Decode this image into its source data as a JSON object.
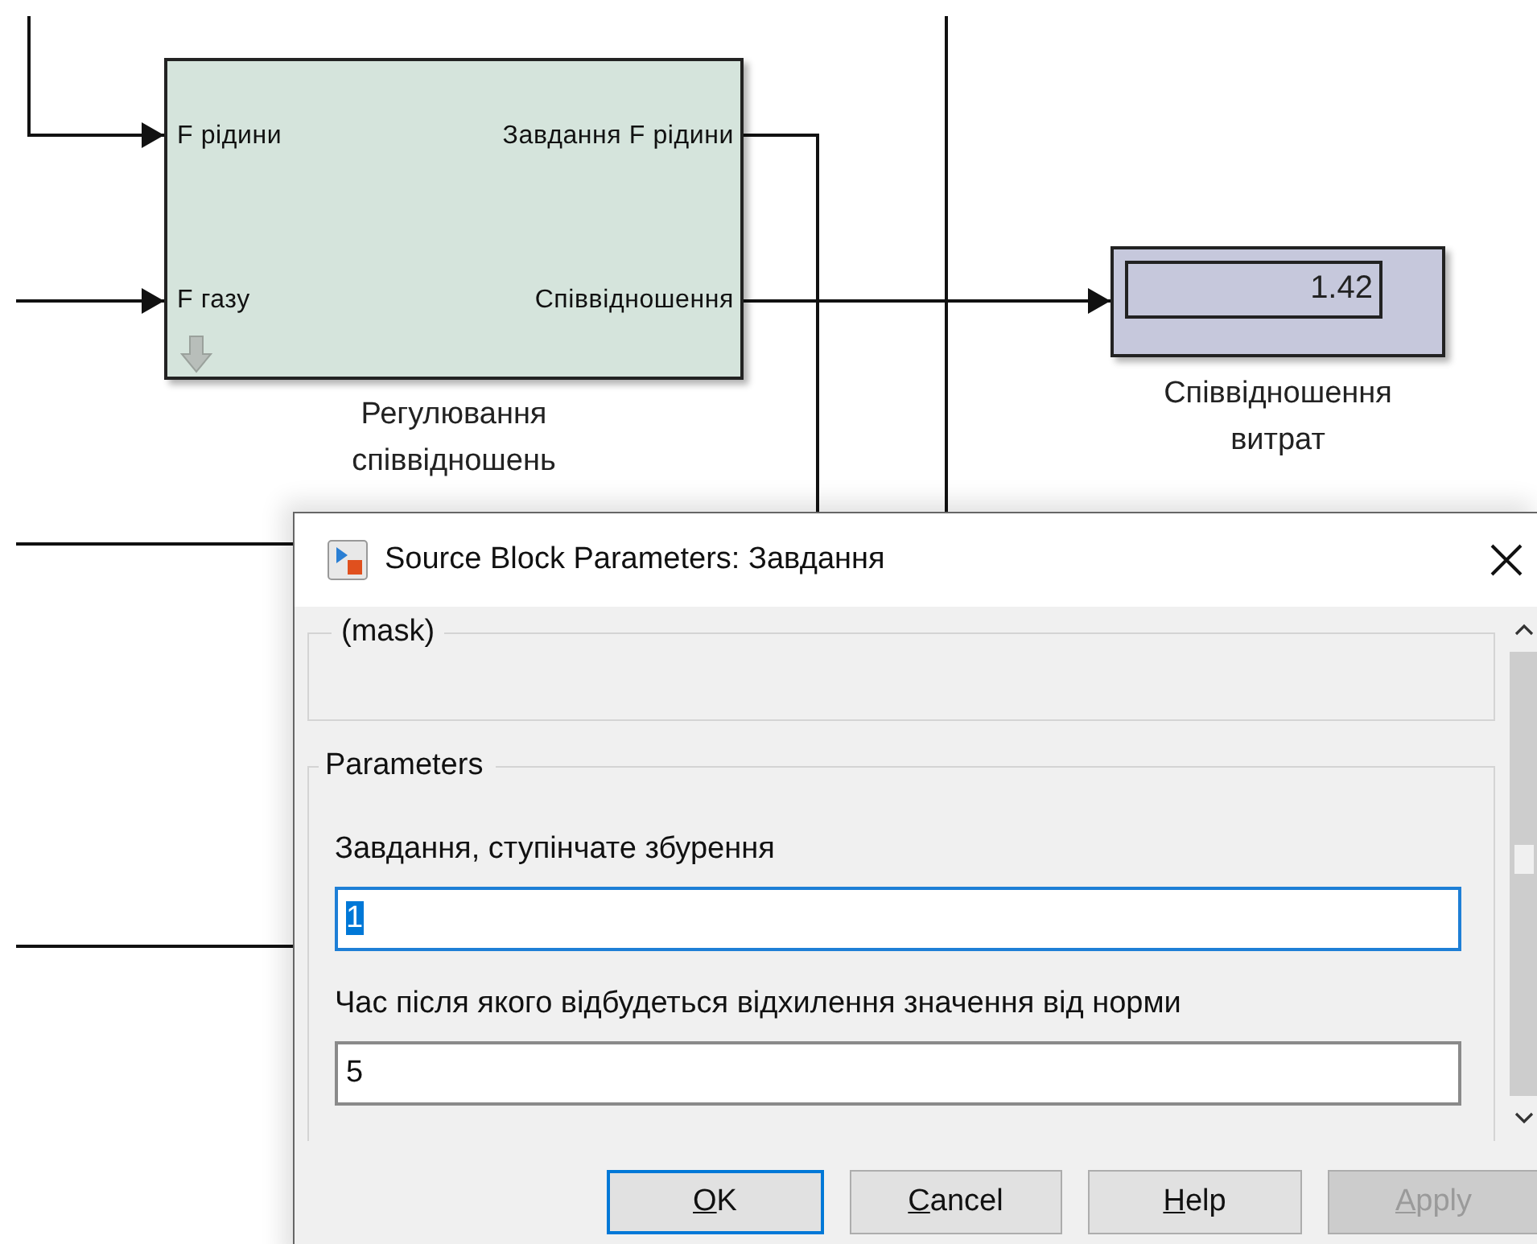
{
  "canvas": {
    "blocks": [
      {
        "kind": "subsystem",
        "inputs": [
          "F рідини",
          "F газу"
        ],
        "outputs": [
          "Завдання F рідини",
          "Співвідношення"
        ],
        "label": [
          "Регулювання",
          "співвідношень"
        ]
      },
      {
        "kind": "display",
        "value": "1.42",
        "label": [
          "Співвідношення",
          "витрат"
        ]
      }
    ]
  },
  "dialog": {
    "title": "Source Block Parameters: Завдання",
    "groups": [
      {
        "title": "(mask)"
      },
      {
        "title": "Parameters"
      }
    ],
    "fields": [
      {
        "label": "Завдання, ступінчате збурення",
        "value": "1",
        "focused": true,
        "value_selected": true
      },
      {
        "label": "Час після якого відбудеться відхилення значення від норми",
        "value": "5",
        "focused": false,
        "value_selected": false
      }
    ],
    "buttons": [
      {
        "label": "OK",
        "default": true,
        "disabled": false
      },
      {
        "label": "Cancel",
        "default": false,
        "disabled": false
      },
      {
        "label": "Help",
        "default": false,
        "disabled": false
      },
      {
        "label": "Apply",
        "default": false,
        "disabled": true
      }
    ]
  }
}
